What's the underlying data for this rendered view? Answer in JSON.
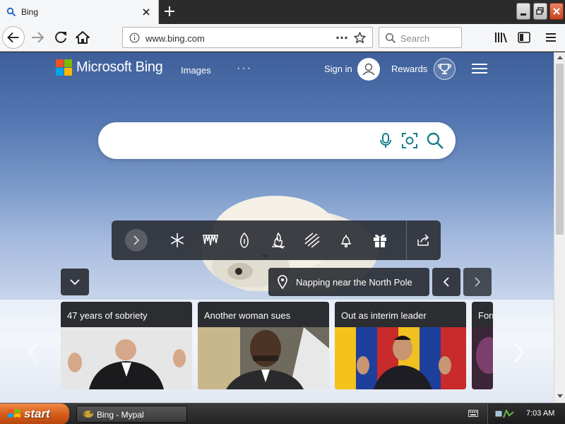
{
  "browser": {
    "tab": {
      "title": "Bing"
    },
    "url": "www.bing.com",
    "search_placeholder": "Search"
  },
  "bing": {
    "brand": "Microsoft Bing",
    "nav": {
      "images": "Images",
      "more": "···"
    },
    "signin": "Sign in",
    "rewards": "Rewards",
    "search_value": "",
    "iconbar_icons": [
      "chevron-right-icon",
      "snowflake-icon",
      "icicles-icon",
      "lantern-icon",
      "campfire-icon",
      "wind-icon",
      "bell-icon",
      "gift-icon",
      "share-icon"
    ],
    "caption": "Napping near the North Pole",
    "cards": [
      {
        "title": "47 years of sobriety"
      },
      {
        "title": "Another woman sues"
      },
      {
        "title": "Out as interim leader"
      },
      {
        "title": "Forr"
      }
    ]
  },
  "taskbar": {
    "start": "start",
    "task": "Bing - Mypal",
    "clock": "7:03 AM"
  },
  "colors": {
    "accent": "#0e7d8c",
    "search_icon": "#177e89",
    "start_orange": "#d35a18"
  }
}
